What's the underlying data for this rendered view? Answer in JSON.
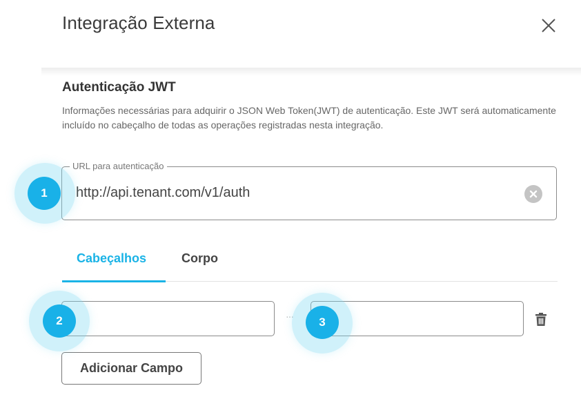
{
  "dialog": {
    "title": "Integração Externa",
    "close_icon": "close-x-icon"
  },
  "jwt_section": {
    "title": "Autenticação JWT",
    "description": "Informações necessárias para adquirir o JSON Web Token(JWT) de autenticação. Este JWT será automaticamente incluído no cabeçalho de todas as operações registradas nesta integração.",
    "url_field": {
      "label": "URL para autenticação",
      "value": "http://api.tenant.com/v1/auth",
      "clear_icon": "clear-circle-icon"
    }
  },
  "tabs": [
    {
      "label": "Cabeçalhos",
      "active": true
    },
    {
      "label": "Corpo",
      "active": false
    }
  ],
  "header_row": {
    "key_value": "",
    "value_value": "",
    "separator": "···",
    "delete_icon": "trash-icon"
  },
  "add_field_button": "Adicionar Campo",
  "step_markers": [
    "1",
    "2",
    "3"
  ],
  "colors": {
    "accent": "#1ab3e6",
    "badge": "#19b1e8",
    "halo": "#78d7f0"
  }
}
